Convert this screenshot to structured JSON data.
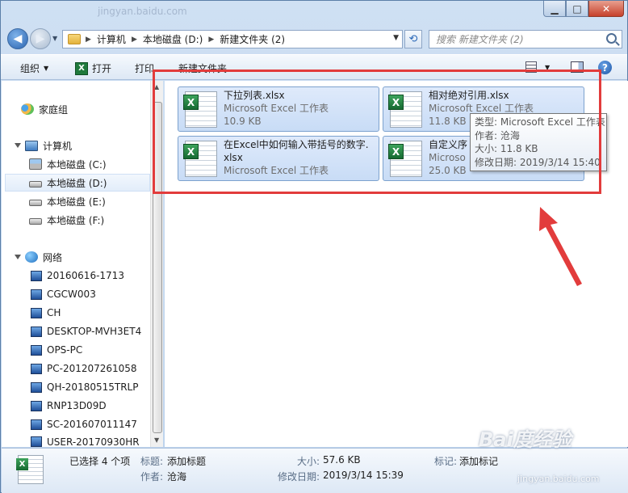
{
  "window": {
    "faint_title": "jingyan.baidu.com",
    "minimize_glyph": "▁",
    "maximize_glyph": "□",
    "close_glyph": "✕"
  },
  "address": {
    "back_glyph": "◀",
    "forward_glyph": "▶",
    "breadcrumbs": [
      "计算机",
      "本地磁盘 (D:)",
      "新建文件夹 (2)"
    ],
    "search_placeholder": "搜索 新建文件夹 (2)"
  },
  "toolbar": {
    "organize": "组织",
    "open": "打开",
    "print": "打印",
    "new_folder": "新建文件夹",
    "help": "?"
  },
  "nav": {
    "homegroup": "家庭组",
    "computer": "计算机",
    "drives": [
      "本地磁盘 (C:)",
      "本地磁盘 (D:)",
      "本地磁盘 (E:)",
      "本地磁盘 (F:)"
    ],
    "network": "网络",
    "hosts": [
      "20160616-1713",
      "CGCW003",
      "CH",
      "DESKTOP-MVH3ET4",
      "OPS-PC",
      "PC-201207261058",
      "QH-20180515TRLP",
      "RNP13D09D",
      "SC-201607011147",
      "USER-20170930HR"
    ]
  },
  "files": [
    {
      "name": "下拉列表.xlsx",
      "type": "Microsoft Excel 工作表",
      "size": "10.9 KB"
    },
    {
      "name": "相对绝对引用.xlsx",
      "type": "Microsoft Excel 工作表",
      "size": "11.8 KB"
    },
    {
      "name": "在Excel中如何输入带括号的数字.",
      "name2": "xlsx",
      "type": "Microsoft Excel 工作表"
    },
    {
      "name": "自定义序",
      "type": "Microso",
      "size": "25.0 KB"
    }
  ],
  "tooltip": {
    "type": "类型: Microsoft Excel 工作表",
    "author": "作者: 沧海",
    "size": "大小: 11.8 KB",
    "modified": "修改日期: 2019/3/14 15:40"
  },
  "details": {
    "selected": "已选择 4 个项",
    "title_label": "标题:",
    "title_value": "添加标题",
    "author_label": "作者:",
    "author_value": "沧海",
    "size_label": "大小:",
    "size_value": "57.6 KB",
    "modified_label": "修改日期:",
    "modified_value": "2019/3/14 15:39",
    "tags_label": "标记:",
    "tags_value": "添加标记"
  },
  "watermark": {
    "main": "Bai度经验",
    "sub": "jingyan.baidu.com"
  },
  "colors": {
    "highlight_box": "#e23c3c",
    "tile_fill": "#c8dcf6",
    "excel_green": "#1f7a3c"
  }
}
